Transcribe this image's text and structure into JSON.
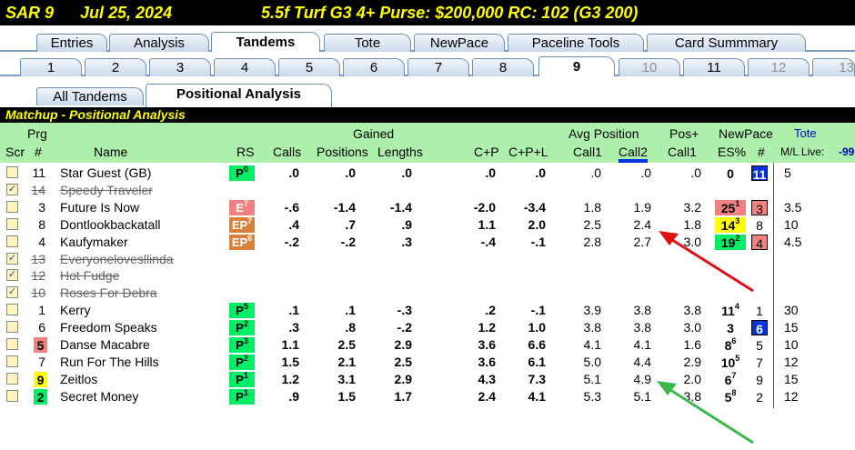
{
  "header": {
    "race": "SAR  9",
    "date": "Jul 25, 2024",
    "info": "5.5f  Turf  G3  4+  Purse: $200,000  RC: 102  (G3 200)"
  },
  "main_tabs": [
    "Entries",
    "Analysis",
    "Tandems",
    "Tote",
    "NewPace",
    "Paceline Tools",
    "Card Summmary"
  ],
  "race_tabs": [
    "1",
    "2",
    "3",
    "4",
    "5",
    "6",
    "7",
    "8",
    "9",
    "10",
    "11",
    "12",
    "13"
  ],
  "sub_tabs": [
    "All Tandems",
    "Positional Analysis"
  ],
  "section_title": "Matchup - Positional Analysis",
  "columns": {
    "scr": "Scr",
    "prg1": "Prg",
    "prg2": "#",
    "name": "Name",
    "rs": "RS",
    "calls": "Calls",
    "gained": "Gained",
    "positions": "Positions",
    "lengths": "Lengths",
    "cp": "C+P",
    "cpl": "C+P+L",
    "avg_position": "Avg Position",
    "call1": "Call1",
    "call2": "Call2",
    "pos_plus": "Pos+",
    "pos_call1": "Call1",
    "newpace": "NewPace",
    "es": "ES%",
    "np_num": "#",
    "tote": "Tote",
    "ml_live": "M/L  Live:",
    "live_val": "-99"
  },
  "colors": {
    "green": "#00ee66",
    "red": "#f28080",
    "orange": "#d9803a",
    "yellow": "#ffff00",
    "blue": "#0033dd"
  },
  "rows": [
    {
      "checked": false,
      "scr": "",
      "prg": "11",
      "name": "Star Guest (GB)",
      "rs": "P",
      "rs_sup": "0",
      "rs_color": "green",
      "calls": ".0",
      "pos": ".0",
      "len": ".0",
      "cp": ".0",
      "cpl": ".0",
      "c1": ".0",
      "c2": ".0",
      "pc1": ".0",
      "es": "0",
      "es_sup": "",
      "es_color": "",
      "np": "11",
      "np_style": "blue-box",
      "ml": "5"
    },
    {
      "checked": true,
      "strike": true,
      "scr": "",
      "prg": "14",
      "name": "Speedy Traveler"
    },
    {
      "checked": false,
      "scr": "",
      "prg": "3",
      "name": "Future Is Now",
      "rs": "E",
      "rs_sup": "7",
      "rs_color": "red",
      "calls": "-.6",
      "pos": "-1.4",
      "len": "-1.4",
      "cp": "-2.0",
      "cpl": "-3.4",
      "c1": "1.8",
      "c2": "1.9",
      "pc1": "3.2",
      "es": "25",
      "es_sup": "1",
      "es_color": "red",
      "np": "3",
      "np_style": "red-box",
      "ml": "3.5"
    },
    {
      "checked": false,
      "scr": "",
      "prg": "8",
      "name": "Dontlookbackatall",
      "rs": "EP",
      "rs_sup": "7",
      "rs_color": "orange",
      "calls": ".4",
      "pos": ".7",
      "len": ".9",
      "cp": "1.1",
      "cpl": "2.0",
      "c1": "2.5",
      "c2": "2.4",
      "pc1": "1.8",
      "es": "14",
      "es_sup": "3",
      "es_color": "yellow",
      "np": "8",
      "np_style": "",
      "ml": "10"
    },
    {
      "checked": false,
      "scr": "",
      "prg": "4",
      "name": "Kaufymaker",
      "rs": "EP",
      "rs_sup": "6",
      "rs_color": "orange",
      "calls": "-.2",
      "pos": "-.2",
      "len": ".3",
      "cp": "-.4",
      "cpl": "-.1",
      "c1": "2.8",
      "c2": "2.7",
      "pc1": "3.0",
      "es": "19",
      "es_sup": "2",
      "es_color": "green",
      "np": "4",
      "np_style": "red-box",
      "ml": "4.5"
    },
    {
      "checked": true,
      "strike": true,
      "scr": "",
      "prg": "13",
      "name": "Everyonelovesllinda"
    },
    {
      "checked": true,
      "strike": true,
      "scr": "",
      "prg": "12",
      "name": "Hot Fudge"
    },
    {
      "checked": true,
      "strike": true,
      "scr": "",
      "prg": "10",
      "name": "Roses For Debra"
    },
    {
      "checked": false,
      "scr": "",
      "prg": "1",
      "name": "Kerry",
      "rs": "P",
      "rs_sup": "5",
      "rs_color": "green",
      "calls": ".1",
      "pos": ".1",
      "len": "-.3",
      "cp": ".2",
      "cpl": "-.1",
      "c1": "3.9",
      "c2": "3.8",
      "pc1": "3.8",
      "es": "11",
      "es_sup": "4",
      "es_color": "",
      "np": "1",
      "np_style": "",
      "ml": "30"
    },
    {
      "checked": false,
      "scr": "",
      "prg": "6",
      "name": "Freedom Speaks",
      "rs": "P",
      "rs_sup": "2",
      "rs_color": "green",
      "calls": ".3",
      "pos": ".8",
      "len": "-.2",
      "cp": "1.2",
      "cpl": "1.0",
      "c1": "3.8",
      "c2": "3.8",
      "pc1": "3.0",
      "es": "3",
      "es_sup": "",
      "es_color": "",
      "np": "6",
      "np_style": "blue-box",
      "ml": "15"
    },
    {
      "checked": false,
      "scr": "5",
      "scr_color": "red",
      "prg": "5",
      "name": "Danse Macabre",
      "rs": "P",
      "rs_sup": "3",
      "rs_color": "green",
      "calls": "1.1",
      "pos": "2.5",
      "len": "2.9",
      "cp": "3.6",
      "cpl": "6.6",
      "c1": "4.1",
      "c2": "4.1",
      "pc1": "1.6",
      "es": "8",
      "es_sup": "6",
      "es_color": "",
      "np": "5",
      "np_style": "",
      "ml": "10"
    },
    {
      "checked": false,
      "scr": "",
      "prg": "7",
      "name": "Run For The Hills",
      "rs": "P",
      "rs_sup": "2",
      "rs_color": "green",
      "calls": "1.5",
      "pos": "2.1",
      "len": "2.5",
      "cp": "3.6",
      "cpl": "6.1",
      "c1": "5.0",
      "c2": "4.4",
      "pc1": "2.9",
      "es": "10",
      "es_sup": "5",
      "es_color": "",
      "np": "7",
      "np_style": "",
      "ml": "12"
    },
    {
      "checked": false,
      "scr": "9",
      "scr_color": "yellow",
      "prg": "9",
      "name": "Zeitlos",
      "rs": "P",
      "rs_sup": "1",
      "rs_color": "green",
      "calls": "1.2",
      "pos": "3.1",
      "len": "2.9",
      "cp": "4.3",
      "cpl": "7.3",
      "c1": "5.1",
      "c2": "4.9",
      "pc1": "2.0",
      "es": "6",
      "es_sup": "7",
      "es_color": "",
      "np": "9",
      "np_style": "",
      "ml": "15"
    },
    {
      "checked": false,
      "scr": "2",
      "scr_color": "green",
      "prg": "2",
      "name": "Secret Money",
      "rs": "P",
      "rs_sup": "1",
      "rs_color": "green",
      "calls": ".9",
      "pos": "1.5",
      "len": "1.7",
      "cp": "2.4",
      "cpl": "4.1",
      "c1": "5.3",
      "c2": "5.1",
      "pc1": "3.8",
      "es": "5",
      "es_sup": "8",
      "es_color": "",
      "np": "2",
      "np_style": "",
      "ml": "12"
    }
  ]
}
